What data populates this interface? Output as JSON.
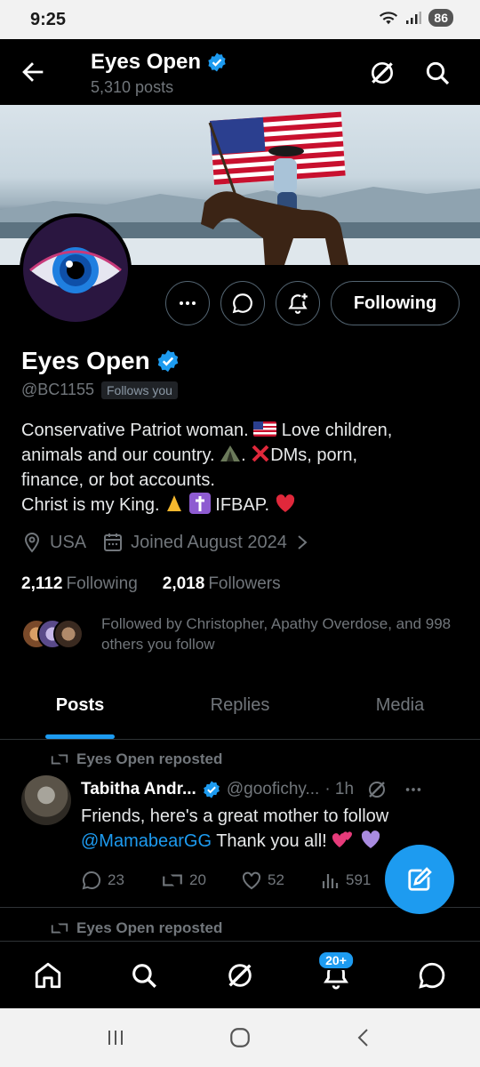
{
  "status_bar": {
    "time": "9:25",
    "battery": "86"
  },
  "header": {
    "title": "Eyes Open",
    "subtitle": "5,310 posts"
  },
  "profile": {
    "name": "Eyes Open",
    "handle": "@BC1155",
    "follows_you": "Follows you",
    "bio_line1_a": "Conservative Patriot woman. ",
    "bio_line1_b": " Love children,",
    "bio_line2_a": "animals and our country. ",
    "bio_line2_b": ". ",
    "bio_line2_c": "DMs, porn,",
    "bio_line3": "finance, or bot accounts.",
    "bio_line4_a": "Christ is my King. ",
    "bio_line4_b": " IFBAP. ",
    "location": "USA",
    "joined": "Joined August 2024",
    "following_count": "2,112",
    "following_label": "Following",
    "followers_count": "2,018",
    "followers_label": "Followers",
    "followed_by": "Followed by Christopher, Apathy Overdose, and 998 others you follow"
  },
  "buttons": {
    "following": "Following"
  },
  "tabs": [
    {
      "label": "Posts"
    },
    {
      "label": "Replies"
    },
    {
      "label": "Media"
    }
  ],
  "post": {
    "repost_label": "Eyes Open reposted",
    "author": "Tabitha Andr...",
    "handle": "@goofichy...",
    "time": "· 1h",
    "text_a": "Friends, here's a great mother to follow",
    "mention": "@MamabearGG",
    "text_b": " Thank you all! ",
    "replies": "23",
    "reposts": "20",
    "likes": "52",
    "views": "591"
  },
  "next_repost_label": "Eyes Open reposted",
  "nav": {
    "notifications_badge": "20+"
  },
  "colors": {
    "accent": "#1d9bf0",
    "background": "#000000",
    "muted": "#71767b"
  }
}
